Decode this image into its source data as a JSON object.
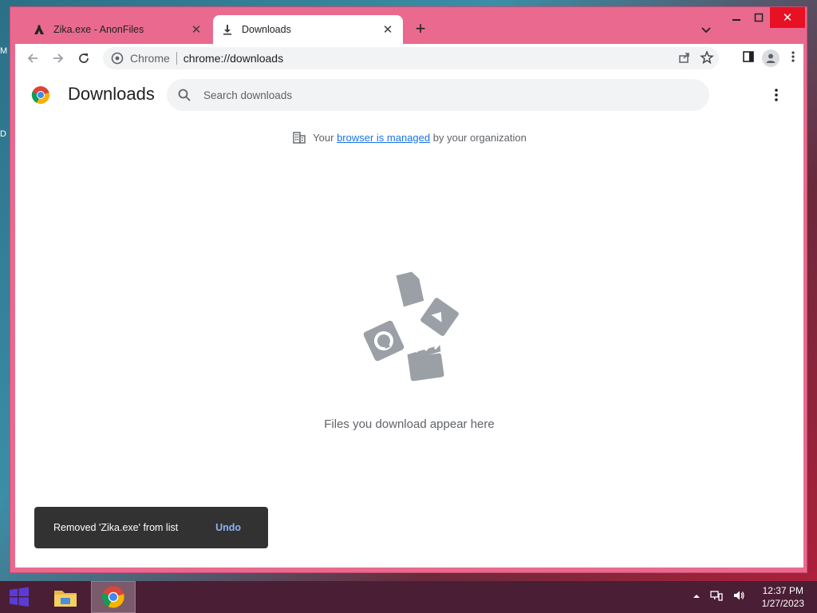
{
  "desktop": {
    "edge_letters": [
      "M",
      "D"
    ]
  },
  "tabs": [
    {
      "title": "Zika.exe - AnonFiles",
      "active": false
    },
    {
      "title": "Downloads",
      "active": true
    }
  ],
  "omnibox": {
    "chip": "Chrome",
    "url": "chrome://downloads"
  },
  "page": {
    "title": "Downloads",
    "search_placeholder": "Search downloads",
    "managed": {
      "prefix": "Your",
      "link": "browser is managed",
      "suffix": "by your organization"
    },
    "empty_message": "Files you download appear here"
  },
  "toast": {
    "message": "Removed 'Zika.exe' from list",
    "action": "Undo"
  },
  "taskbar": {
    "time": "12:37 PM",
    "date": "1/27/2023"
  },
  "colors": {
    "frame": "#e96a8e",
    "taskbar": "#4a1e34",
    "link": "#1a73e8",
    "toast_action": "#8ab4f8",
    "close_hover": "#e81123"
  }
}
